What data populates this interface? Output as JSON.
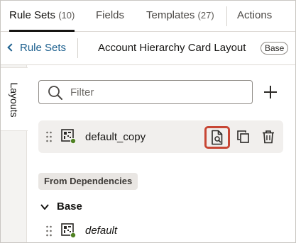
{
  "tabs": [
    {
      "label": "Rule Sets",
      "count": "(10)",
      "active": true
    },
    {
      "label": "Fields",
      "count": "",
      "active": false
    },
    {
      "label": "Templates",
      "count": "(27)",
      "active": false
    },
    {
      "label": "Actions",
      "count": "",
      "active": false
    }
  ],
  "breadcrumb": {
    "back_label": "Rule Sets",
    "title": "Account Hierarchy Card Layout",
    "badge": "Base"
  },
  "side_tab": {
    "label": "Layouts"
  },
  "filter": {
    "placeholder": "Filter",
    "value": ""
  },
  "layouts": [
    {
      "name": "default_copy",
      "status_color": "#508223"
    }
  ],
  "dependencies": {
    "heading": "From Dependencies",
    "group_label": "Base",
    "items": [
      {
        "name": "default",
        "status_color": "#508223"
      }
    ]
  },
  "colors": {
    "accent_link": "#1b5f8e",
    "highlight_border": "#c74634",
    "status_dot": "#508223"
  }
}
